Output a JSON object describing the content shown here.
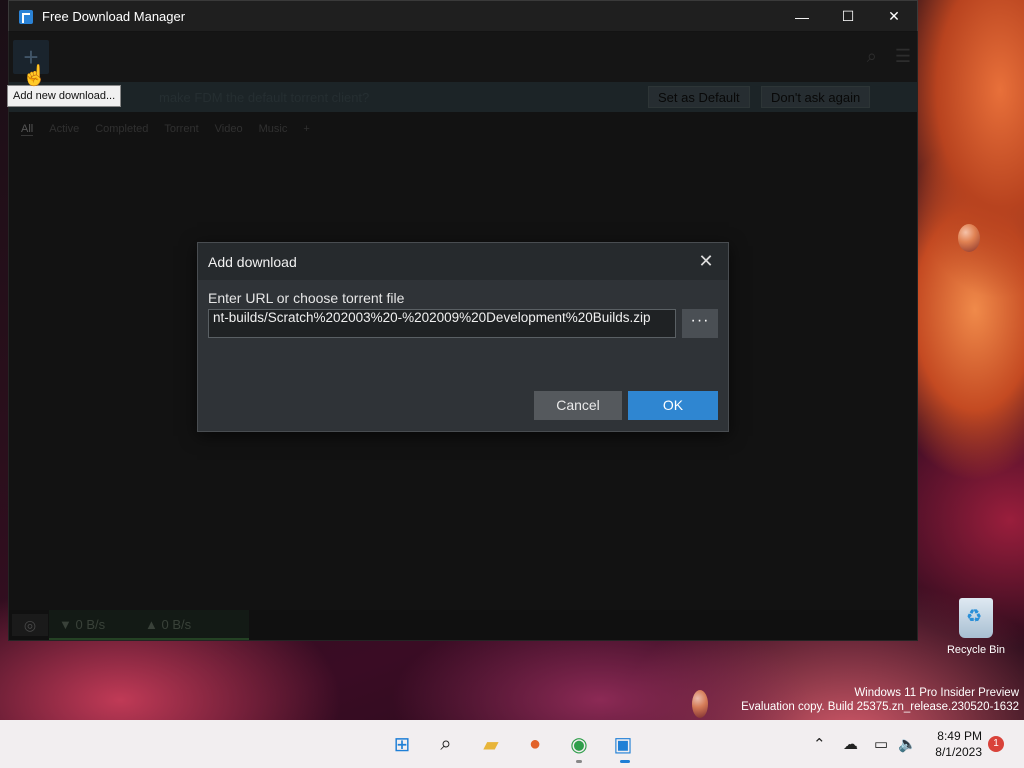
{
  "window": {
    "title": "Free Download Manager",
    "minimize": "—",
    "maximize": "☐",
    "close": "✕"
  },
  "toolbar": {
    "add_glyph": "+",
    "tooltip": "Add new download..."
  },
  "banner": {
    "text": "make FDM the default torrent client?",
    "set_default": "Set as Default",
    "dont_ask": "Don't ask again"
  },
  "filters": {
    "items": [
      "All",
      "Active",
      "Completed",
      "Torrent",
      "Video",
      "Music",
      "+"
    ]
  },
  "status": {
    "down": "▼ 0 B/s",
    "up": "▲ 0 B/s"
  },
  "dialog": {
    "title": "Add download",
    "label": "Enter URL or choose torrent file",
    "url_value": "nt-builds/Scratch%202003%20-%202009%20Development%20Builds.zip",
    "browse": "···",
    "cancel": "Cancel",
    "ok": "OK",
    "close": "✕"
  },
  "desktop": {
    "recycle_bin": "Recycle Bin",
    "watermark_line1": "Windows 11 Pro Insider Preview",
    "watermark_line2": "Evaluation copy. Build 25375.zn_release.230520-1632"
  },
  "taskbar": {
    "time": "8:49 PM",
    "date": "8/1/2023",
    "notification_count": "1"
  }
}
